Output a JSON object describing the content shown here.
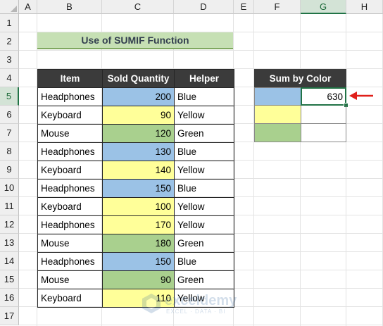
{
  "columns": [
    "A",
    "B",
    "C",
    "D",
    "E",
    "F",
    "G",
    "H"
  ],
  "rows": [
    "1",
    "2",
    "3",
    "4",
    "5",
    "6",
    "7",
    "8",
    "9",
    "10",
    "11",
    "12",
    "13",
    "14",
    "15",
    "16",
    "17"
  ],
  "active_cell": "G5",
  "title": "Use of SUMIF Function",
  "table": {
    "headers": [
      "Item",
      "Sold Quantity",
      "Helper"
    ],
    "rows": [
      {
        "item": "Headphones",
        "qty": "200",
        "helper": "Blue",
        "color": "blue"
      },
      {
        "item": "Keyboard",
        "qty": "90",
        "helper": "Yellow",
        "color": "yellow"
      },
      {
        "item": "Mouse",
        "qty": "120",
        "helper": "Green",
        "color": "green"
      },
      {
        "item": "Headphones",
        "qty": "130",
        "helper": "Blue",
        "color": "blue"
      },
      {
        "item": "Keyboard",
        "qty": "140",
        "helper": "Yellow",
        "color": "yellow"
      },
      {
        "item": "Headphones",
        "qty": "150",
        "helper": "Blue",
        "color": "blue"
      },
      {
        "item": "Keyboard",
        "qty": "100",
        "helper": "Yellow",
        "color": "yellow"
      },
      {
        "item": "Headphones",
        "qty": "170",
        "helper": "Yellow",
        "color": "yellow"
      },
      {
        "item": "Mouse",
        "qty": "180",
        "helper": "Green",
        "color": "green"
      },
      {
        "item": "Headphones",
        "qty": "150",
        "helper": "Blue",
        "color": "blue"
      },
      {
        "item": "Mouse",
        "qty": "90",
        "helper": "Green",
        "color": "green"
      },
      {
        "item": "Keyboard",
        "qty": "110",
        "helper": "Yellow",
        "color": "yellow"
      }
    ]
  },
  "sum_by_color": {
    "header": "Sum by Color",
    "rows": [
      {
        "color": "blue",
        "value": "630"
      },
      {
        "color": "yellow",
        "value": ""
      },
      {
        "color": "green",
        "value": ""
      }
    ]
  },
  "colors": {
    "blue": "#9bc2e6",
    "yellow": "#ffff99",
    "green": "#a9d08e",
    "header_dark": "#3b3b3b",
    "title_green": "#c6e0b4",
    "arrow_red": "#e0201a",
    "selection_green": "#217346"
  },
  "watermark": {
    "name": "exceldemy",
    "tagline": "EXCEL · DATA · BI"
  }
}
